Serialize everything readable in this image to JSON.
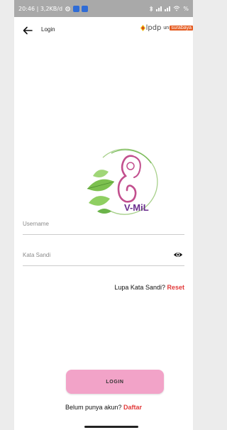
{
  "status_bar": {
    "time_speed": "20:46 | 3,2KB/d",
    "right_text": "% ",
    "icons": [
      "settings-icon",
      "notification-icon",
      "notification-icon",
      "bluetooth-icon",
      "signal-icon",
      "signal-icon",
      "wifi-icon",
      "battery-icon"
    ]
  },
  "header": {
    "back_icon": "arrow-left-icon",
    "title": "Login",
    "lpdp_text": "lpdp",
    "unesa_text": "un",
    "unesa_tag": "surabaya"
  },
  "logo": {
    "text": "V-MiL"
  },
  "form": {
    "username_placeholder": "Username",
    "password_placeholder": "Kata Sandi",
    "eye_icon": "eye-icon",
    "forgot_prefix": "Lupa Kata Sandi?",
    "forgot_link": "Reset"
  },
  "login_button": {
    "label": "LOGIN"
  },
  "register": {
    "prefix": "Belum punya akun?",
    "link": "Daftar"
  },
  "colors": {
    "accent": "#f2a3c8",
    "link": "#e23a3a",
    "logo_purple": "#6b2d8e",
    "leaf_green": "#6bb44a"
  }
}
